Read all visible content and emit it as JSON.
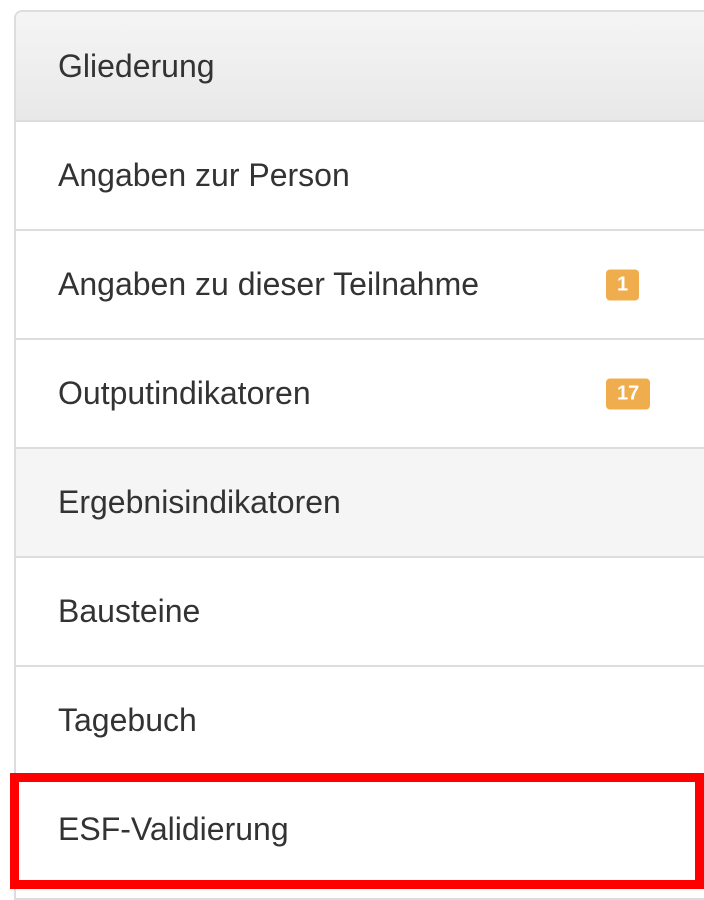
{
  "panel": {
    "heading": "Gliederung"
  },
  "nav": {
    "items": [
      {
        "label": "Angaben zur Person",
        "badge": ""
      },
      {
        "label": "Angaben zu dieser Teilnahme",
        "badge": "1"
      },
      {
        "label": "Outputindikatoren",
        "badge": "17"
      },
      {
        "label": "Ergebnisindikatoren",
        "badge": ""
      },
      {
        "label": "Bausteine",
        "badge": ""
      },
      {
        "label": "Tagebuch",
        "badge": ""
      },
      {
        "label": "ESF-Validierung",
        "badge": ""
      }
    ],
    "active_index": 3
  },
  "colors": {
    "badge": "#f0ad4e",
    "highlight": "#ff0000",
    "border": "#dddddd",
    "text": "#333333"
  }
}
